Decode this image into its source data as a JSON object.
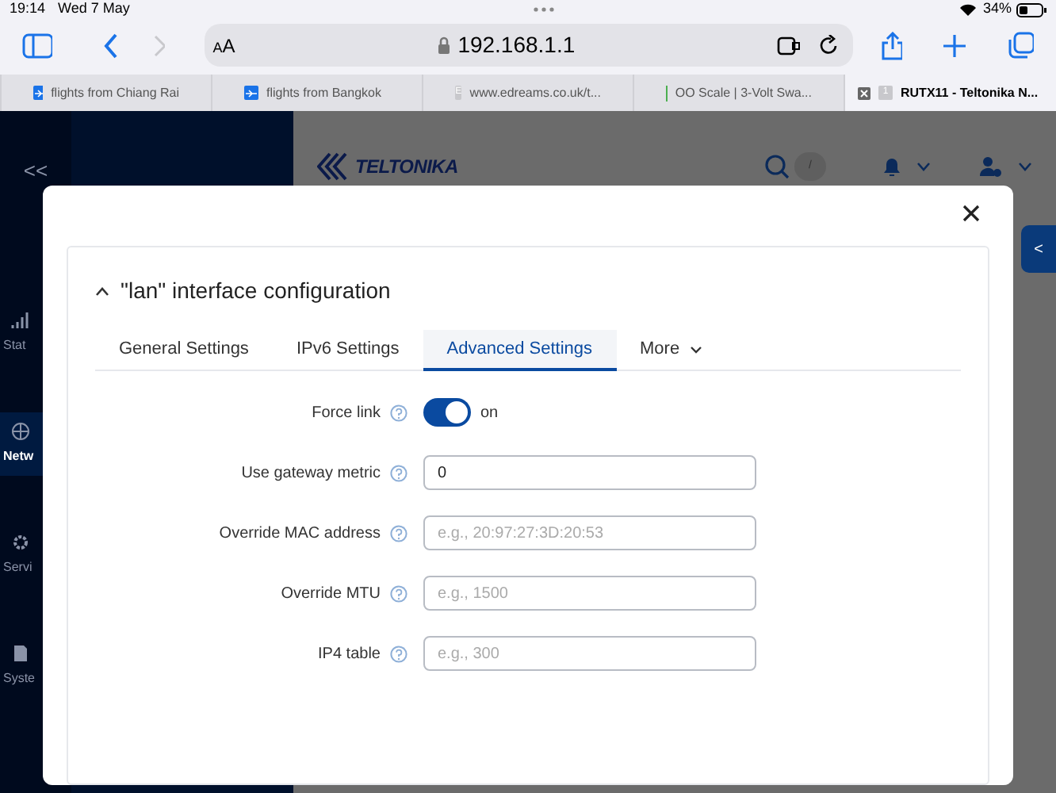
{
  "status_bar": {
    "time": "19:14",
    "date": "Wed 7 May",
    "battery": "34%"
  },
  "browser": {
    "text_size_small": "A",
    "text_size_large": "A",
    "url": "192.168.1.1",
    "tabs": [
      {
        "title": "flights from Chiang Rai",
        "selected": false
      },
      {
        "title": "flights from Bangkok",
        "selected": false
      },
      {
        "title": "www.edreams.co.uk/t...",
        "favicon_letter": "E",
        "selected": false
      },
      {
        "title": "OO Scale | 3-Volt Swa...",
        "selected": false
      },
      {
        "title": "RUTX11 - Teltonika N...",
        "favicon_letter": "1",
        "selected": true
      }
    ]
  },
  "sidebar": {
    "collapse": "<<",
    "items": [
      {
        "label": "Stat",
        "selected": false
      },
      {
        "label": "Netw",
        "selected": true
      },
      {
        "label": "Servi",
        "selected": false
      },
      {
        "label": "Syste",
        "selected": false
      }
    ]
  },
  "header": {
    "logo": "TELTONIKA",
    "search_shortcut": "/",
    "side_tab": "<"
  },
  "dialog": {
    "section": {
      "title": "\"lan\" interface configuration",
      "expanded": true
    },
    "tabs": [
      {
        "label": "General Settings",
        "selected": false,
        "kind": "tab"
      },
      {
        "label": "IPv6 Settings",
        "selected": false,
        "kind": "tab"
      },
      {
        "label": "Advanced Settings",
        "selected": true,
        "kind": "tab"
      },
      {
        "label": "More",
        "selected": false,
        "kind": "dropdown"
      }
    ],
    "fields": [
      {
        "label": "Force link",
        "kind": "switch",
        "on": true,
        "state_text": "on"
      },
      {
        "label": "Use gateway metric",
        "kind": "input",
        "value": "0"
      },
      {
        "label": "Override MAC address",
        "kind": "input",
        "placeholder": "e.g., 20:97:27:3D:20:53"
      },
      {
        "label": "Override MTU",
        "kind": "input",
        "placeholder": "e.g., 1500"
      },
      {
        "label": "IP4 table",
        "kind": "input",
        "placeholder": "e.g., 300"
      }
    ]
  }
}
